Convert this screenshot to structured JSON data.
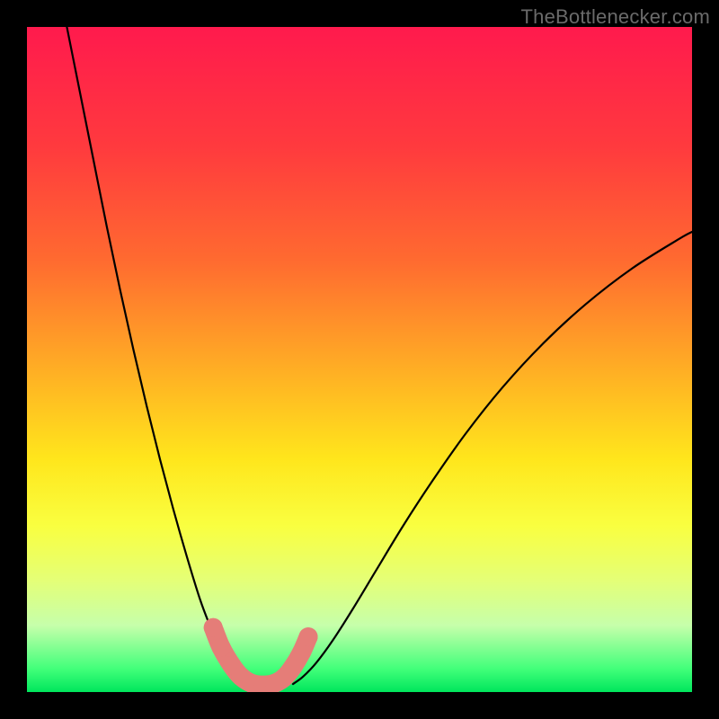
{
  "watermark": "TheBottlenecker.com",
  "chart_data": {
    "type": "line",
    "title": "",
    "xlabel": "",
    "ylabel": "",
    "xlim": [
      0,
      100
    ],
    "ylim": [
      0,
      100
    ],
    "grid": false,
    "background_gradient": {
      "stops": [
        {
          "offset": 0,
          "color": "#ff1a4d"
        },
        {
          "offset": 0.18,
          "color": "#ff3a3e"
        },
        {
          "offset": 0.35,
          "color": "#ff6a30"
        },
        {
          "offset": 0.52,
          "color": "#ffb024"
        },
        {
          "offset": 0.65,
          "color": "#ffe61c"
        },
        {
          "offset": 0.75,
          "color": "#f9ff40"
        },
        {
          "offset": 0.83,
          "color": "#e5ff75"
        },
        {
          "offset": 0.9,
          "color": "#c6ffab"
        },
        {
          "offset": 0.965,
          "color": "#42ff7a"
        },
        {
          "offset": 1.0,
          "color": "#00e65c"
        }
      ]
    },
    "series": [
      {
        "name": "left-curve",
        "color": "#000000",
        "width": 2.2,
        "x": [
          6,
          8,
          10,
          12,
          14,
          16,
          18,
          20,
          22,
          24,
          26,
          27.5,
          29,
          30.5,
          32,
          33
        ],
        "y": [
          100,
          90,
          80,
          70,
          60.5,
          51.5,
          43,
          35,
          27.5,
          20.5,
          14,
          10,
          6.5,
          4,
          2,
          1.2
        ]
      },
      {
        "name": "right-curve",
        "color": "#000000",
        "width": 2.2,
        "x": [
          40,
          41.5,
          43.5,
          46,
          49,
          52.5,
          56.5,
          61,
          66,
          71.5,
          77.5,
          84,
          91,
          98,
          100
        ],
        "y": [
          1.2,
          2.3,
          4.4,
          7.8,
          12.5,
          18.3,
          24.9,
          31.8,
          38.9,
          45.8,
          52.3,
          58.3,
          63.7,
          68.1,
          69.2
        ]
      },
      {
        "name": "marker-path",
        "type": "marker-line",
        "color": "#e57d78",
        "width": 21,
        "x": [
          28.0,
          29.2,
          30.8,
          32.2,
          33.8,
          35.5,
          37.2,
          38.7,
          40.0,
          41.3,
          42.3
        ],
        "y": [
          9.7,
          6.7,
          4.0,
          2.3,
          1.3,
          1.05,
          1.3,
          2.2,
          3.8,
          6.0,
          8.3
        ]
      }
    ],
    "markers": {
      "color": "#e57d78",
      "radius": 10.5,
      "points": [
        {
          "x": 28.0,
          "y": 9.7
        },
        {
          "x": 29.2,
          "y": 6.7
        },
        {
          "x": 30.8,
          "y": 4.0
        },
        {
          "x": 32.2,
          "y": 2.3
        },
        {
          "x": 33.8,
          "y": 1.3
        },
        {
          "x": 35.5,
          "y": 1.05
        },
        {
          "x": 37.2,
          "y": 1.3
        },
        {
          "x": 38.7,
          "y": 2.2
        },
        {
          "x": 40.0,
          "y": 3.8
        },
        {
          "x": 41.3,
          "y": 6.0
        },
        {
          "x": 42.3,
          "y": 8.3
        }
      ]
    }
  }
}
